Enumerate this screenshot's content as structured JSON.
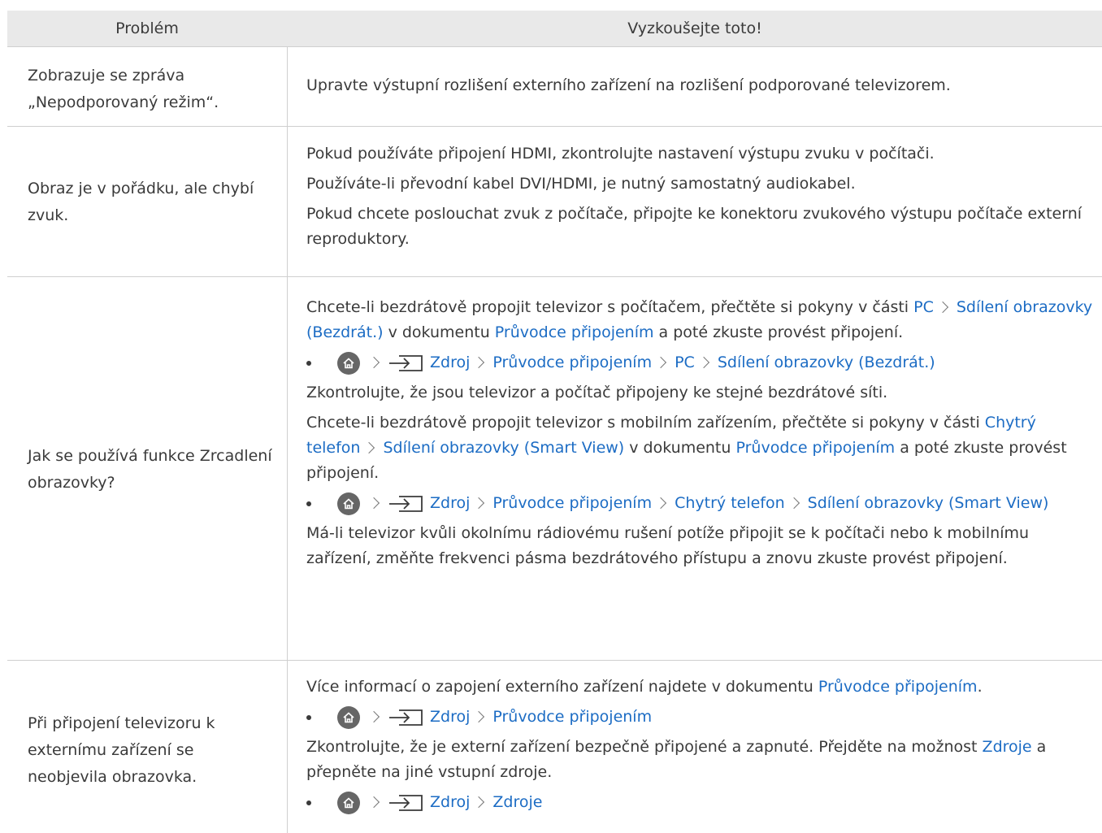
{
  "header": {
    "problem": "Problém",
    "solution": "Vyzkoušejte toto!"
  },
  "rows": [
    {
      "problem": "Zobrazuje se zpráva „Nepodporovaný režim“.",
      "s1": "Upravte výstupní rozlišení externího zařízení na rozlišení podporované televizorem."
    },
    {
      "problem": "Obraz je v pořádku, ale chybí zvuk.",
      "s1": "Pokud používáte připojení HDMI, zkontrolujte nastavení výstupu zvuku v počítači.",
      "s2": "Používáte-li převodní kabel DVI/HDMI, je nutný samostatný audiokabel.",
      "s3": "Pokud chcete poslouchat zvuk z počítače, připojte ke konektoru zvukového výstupu počítače externí reproduktory."
    },
    {
      "problem": "Jak se používá funkce Zrcadlení obrazovky?",
      "p1a": "Chcete-li bezdrátově propojit televizor s počítačem, přečtěte si pokyny v části ",
      "p1_link1": "PC",
      "p1_link2": "Sdílení obrazovky (Bezdrát.)",
      "p1b": " v dokumentu ",
      "p1_link3": "Průvodce připojením",
      "p1c": " a poté zkuste provést připojení.",
      "b1": [
        "Zdroj",
        "Průvodce připojením",
        "PC",
        "Sdílení obrazovky (Bezdrát.)"
      ],
      "p2": "Zkontrolujte, že jsou televizor a počítač připojeny ke stejné bezdrátové síti.",
      "p3a": "Chcete-li bezdrátově propojit televizor s mobilním zařízením, přečtěte si pokyny v části ",
      "p3_link1": "Chytrý telefon",
      "p3_link2": "Sdílení obrazovky (Smart View)",
      "p3b": " v dokumentu ",
      "p3_link3": "Průvodce připojením",
      "p3c": " a poté zkuste provést připojení.",
      "b2": [
        "Zdroj",
        "Průvodce připojením",
        "Chytrý telefon",
        "Sdílení obrazovky (Smart View)"
      ],
      "p4": "Má-li televizor kvůli okolnímu rádiovému rušení potíže připojit se k počítači nebo k mobilnímu zařízení, změňte frekvenci pásma bezdrátového přístupu a znovu zkuste provést připojení."
    },
    {
      "problem": "Při připojení televizoru k externímu zařízení se neobjevila obrazovka.",
      "p1a": "Více informací o zapojení externího zařízení najdete v dokumentu ",
      "p1_link": "Průvodce připojením",
      "p1b": ".",
      "b1": [
        "Zdroj",
        "Průvodce připojením"
      ],
      "p2": "Zkontrolujte, že je externí zařízení bezpečně připojené a zapnuté. Přejděte na možnost ",
      "p2_link": "Zdroje",
      "p2b": " a přepněte na jiné vstupní zdroje.",
      "b2": [
        "Zdroj",
        "Zdroje"
      ]
    }
  ],
  "colors": {
    "link": "#1c6cc4",
    "header_bg": "#e9e9e9",
    "text": "#3a3a3a"
  },
  "icons": [
    "home-icon",
    "source-icon",
    "chevron-right-icon"
  ]
}
